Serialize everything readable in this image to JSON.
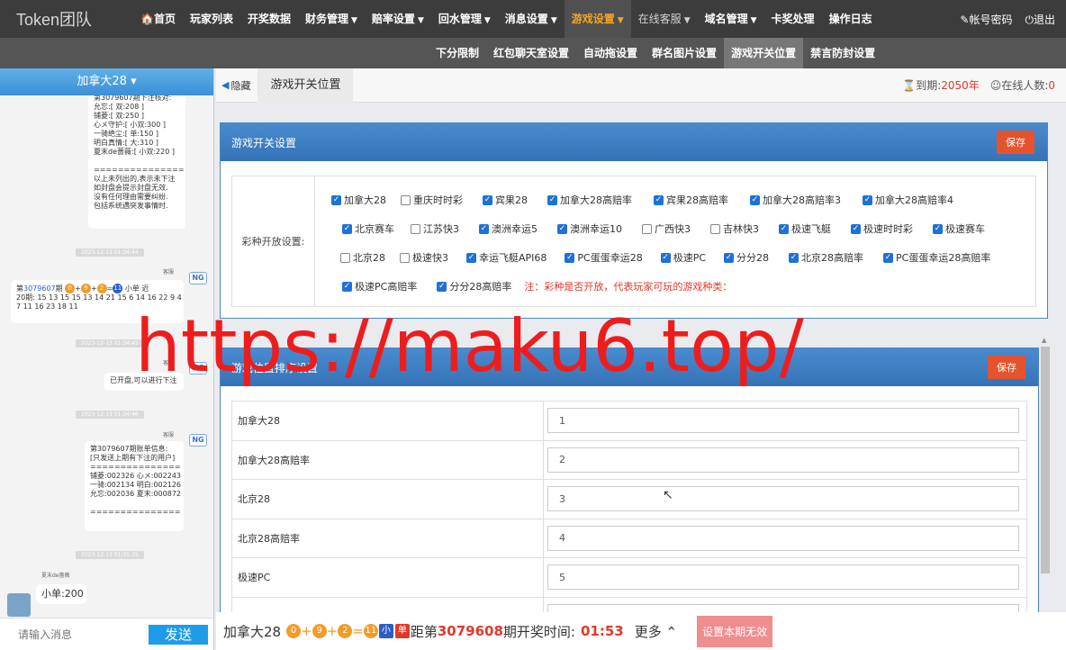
{
  "brand": "Token团队",
  "nav": {
    "items": [
      {
        "label": "🏠首页",
        "caret": false
      },
      {
        "label": "玩家列表",
        "caret": false
      },
      {
        "label": "开奖数据",
        "caret": false
      },
      {
        "label": "财务管理",
        "caret": true
      },
      {
        "label": "赔率设置",
        "caret": true
      },
      {
        "label": "回水管理",
        "caret": true
      },
      {
        "label": "消息设置",
        "caret": true
      },
      {
        "label": "游戏设置",
        "caret": true,
        "active": true
      },
      {
        "label": "在线客服",
        "caret": true,
        "dim": true
      },
      {
        "label": "域名管理",
        "caret": true
      },
      {
        "label": "卡奖处理",
        "caret": false
      },
      {
        "label": "操作日志",
        "caret": false
      }
    ],
    "account": "帐号密码",
    "logout": "退出"
  },
  "subnav": [
    "下分限制",
    "红包聊天室设置",
    "自动拖设置",
    "群名图片设置",
    "游戏开关位置",
    "禁言防封设置"
  ],
  "subnav_active": "游戏开关位置",
  "chat": {
    "title": "加拿大28",
    "msg1": "第3079607期下注核对:\n允忘:[ 双:208 ]\n铺菱:[ 双:250 ]\n心メ守护:[ 小双:300 ]\n一骑绝尘:[ 单:150 ]\n明白真情:[ 大:310 ]\n夏末de蔷薇:[ 小双:220 ]\n\n===============\n以上未列出的,表示未下注\n如封盘会提示封盘无效.\n没有任何理由需要纠纷.\n包括系统遇突发事情时.",
    "ts1": "2023-12-13 01:34:44",
    "sender": "客服",
    "avatar": "NG",
    "msg2_prefix": "第",
    "msg2_issue": "3079607",
    "msg2_mid": "期",
    "msg2_balls": [
      "0",
      "9",
      "2",
      "11"
    ],
    "msg2_result": "小单 近",
    "msg2_tail": "20期: 15 13 15 15 13 14 21 15 6 14 16 22 9 4\n7 11 16 23 18 11",
    "ts2": "2023-12-13 01:34:45",
    "msg3": "已开盘,可以进行下注",
    "ts3": "2023-12-13 01:34:46",
    "msg4": "第3079607期账单信息:\n[只发送上期有下注的用户]\n===============\n铺菱:002326 心メ:002243\n一骑:002134 明白:002126\n允忘:002036 夏末:000872\n\n===============",
    "ts4": "2023-12-13 01:35:25",
    "user_name": "夏末de蔷薇",
    "user_msg": "小单:200",
    "input_placeholder": "请输入消息",
    "send": "发送"
  },
  "tabbar": {
    "hide": "隐藏",
    "tab": "游戏开关位置",
    "expire_label": "到期:",
    "expire_value": "2050年",
    "online_label": "在线人数:",
    "online_value": "0"
  },
  "switch_panel": {
    "title": "游戏开关设置",
    "save": "保存",
    "label": "彩种开放设置:",
    "rows": [
      [
        {
          "n": "加拿大28",
          "c": true
        },
        {
          "n": "重庆时时彩",
          "c": false
        },
        {
          "n": "宾果28",
          "c": true
        },
        {
          "n": "加拿大28高赔率",
          "c": true
        },
        {
          "n": "宾果28高赔率",
          "c": true
        },
        {
          "n": "加拿大28高赔率3",
          "c": true
        },
        {
          "n": "加拿大28高赔率4",
          "c": true
        }
      ],
      [
        {
          "n": "北京赛车",
          "c": true
        },
        {
          "n": "江苏快3",
          "c": false
        },
        {
          "n": "澳洲幸运5",
          "c": true
        },
        {
          "n": "澳洲幸运10",
          "c": true
        },
        {
          "n": "广西快3",
          "c": false
        },
        {
          "n": "吉林快3",
          "c": false
        },
        {
          "n": "极速飞艇",
          "c": true
        },
        {
          "n": "极速时时彩",
          "c": true
        },
        {
          "n": "极速赛车",
          "c": true
        }
      ],
      [
        {
          "n": "北京28",
          "c": false
        },
        {
          "n": "极速快3",
          "c": false
        },
        {
          "n": "幸运飞艇API68",
          "c": true
        },
        {
          "n": "PC蛋蛋幸运28",
          "c": true
        },
        {
          "n": "极速PC",
          "c": true
        },
        {
          "n": "分分28",
          "c": true
        },
        {
          "n": "北京28高赔率",
          "c": true
        },
        {
          "n": "PC蛋蛋幸运28高赔率",
          "c": true
        }
      ],
      [
        {
          "n": "极速PC高赔率",
          "c": true
        },
        {
          "n": "分分28高赔率",
          "c": true
        }
      ]
    ],
    "note": "注：彩种是否开放，代表玩家可玩的游戏种类："
  },
  "sort_panel": {
    "title": "游戏位置排序设置",
    "save": "保存",
    "rows": [
      {
        "name": "加拿大28",
        "value": "1"
      },
      {
        "name": "加拿大28高赔率",
        "value": "2"
      },
      {
        "name": "北京28",
        "value": "3"
      },
      {
        "name": "北京28高赔率",
        "value": "4"
      },
      {
        "name": "极速PC",
        "value": "5"
      },
      {
        "name": "",
        "value": ""
      }
    ]
  },
  "bottom": {
    "game": "加拿大28",
    "balls": [
      "0",
      "9",
      "2",
      "11"
    ],
    "size": "小",
    "parity": "单",
    "dist_prefix": "距第",
    "issue": "3079608",
    "dist_suffix": "期开奖时间:",
    "countdown": "01:53",
    "more": "更多",
    "invalid": "设置本期无效"
  },
  "watermark": "https://maku6.top/",
  "colors": {
    "nav_bg": "#3c3c3c",
    "panel_head": "#3a7cc0",
    "save": "#e5532d",
    "accent": "#f5a623",
    "danger": "#e0392b"
  }
}
